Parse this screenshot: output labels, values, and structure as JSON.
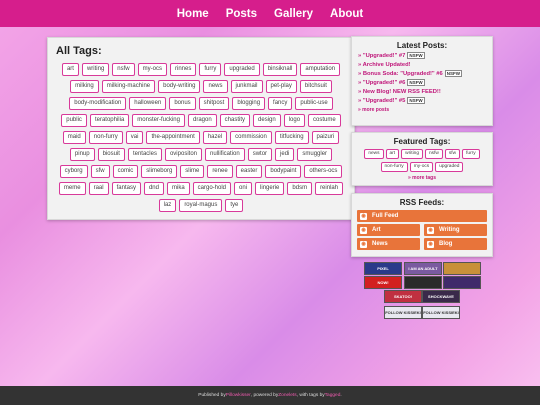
{
  "nav": [
    "Home",
    "Posts",
    "Gallery",
    "About"
  ],
  "all_tags": {
    "title": "All Tags:",
    "tags": [
      "art",
      "writing",
      "nsfw",
      "my-ocs",
      "rinnes",
      "furry",
      "upgraded",
      "binsiknall",
      "amputation",
      "milking",
      "milking-machine",
      "body-writing",
      "news",
      "junkmail",
      "pet-play",
      "bitchsuit",
      "body-modification",
      "halloween",
      "bonus",
      "shitpost",
      "blogging",
      "fancy",
      "public-use",
      "public",
      "teratophilia",
      "monster-fucking",
      "dragon",
      "chastity",
      "design",
      "logo",
      "costume",
      "maid",
      "non-furry",
      "vai",
      "the-appointment",
      "hazel",
      "commission",
      "titfucking",
      "paizuri",
      "pinup",
      "biosuit",
      "tentacles",
      "ovipositon",
      "nullification",
      "swtor",
      "jedi",
      "smuggler",
      "cyborg",
      "sfw",
      "comic",
      "slimeborg",
      "slime",
      "renee",
      "easter",
      "bodypaint",
      "others-ocs",
      "meme",
      "raal",
      "fantasy",
      "dnd",
      "mika",
      "cargo-hold",
      "oni",
      "lingerie",
      "bdsm",
      "reinlah",
      "laz",
      "royal-magus",
      "tye"
    ]
  },
  "latest": {
    "title": "Latest Posts:",
    "posts": [
      {
        "text": "» \"Upgraded!\" #7",
        "nsfw": "NSFW"
      },
      {
        "text": "» Archive Updated!",
        "nsfw": ""
      },
      {
        "text": "» Bonus Soda: \"Upgraded!\" #6",
        "nsfw": "NSFW"
      },
      {
        "text": "» \"Upgraded!\" #6",
        "nsfw": "NSFW"
      },
      {
        "text": "» New Blog! NEW RSS FEED!!",
        "nsfw": ""
      },
      {
        "text": "» \"Upgraded!\" #5",
        "nsfw": "NSFW"
      }
    ],
    "more": "» more posts"
  },
  "featured": {
    "title": "Featured Tags:",
    "tags": [
      "news",
      "art",
      "writing",
      "nsfw",
      "sfw",
      "furry",
      "non-furry",
      "my-ocs",
      "upgraded"
    ],
    "more": "» more tags"
  },
  "rss": {
    "title": "RSS Feeds:",
    "full": "Full Feed",
    "art": "Art",
    "writing": "Writing",
    "news": "News",
    "blog": "Blog"
  },
  "badges": [
    {
      "name": "badge-1",
      "color": "#2a3a8a",
      "text": "PIXEL"
    },
    {
      "name": "badge-2",
      "color": "#7a5aa0",
      "text": "I AM AN ADULT"
    },
    {
      "name": "badge-3",
      "color": "#c8903a",
      "text": ""
    },
    {
      "name": "badge-4",
      "color": "#d22020",
      "text": "NOW!"
    },
    {
      "name": "badge-5",
      "color": "#2a2a2a",
      "text": ""
    },
    {
      "name": "badge-6",
      "color": "#402a6a",
      "text": ""
    },
    {
      "name": "badge-7",
      "color": "#c03040",
      "text": "SKATOO!"
    },
    {
      "name": "badge-8",
      "color": "#3a2a4a",
      "text": "SHOCKWAVE"
    },
    {
      "name": "badge-9",
      "color": "#e8e8f0",
      "text": "FOLLOW KISSIEKI"
    },
    {
      "name": "badge-10",
      "color": "#e8e8f0",
      "text": "FOLLOW KISSIEKI"
    }
  ],
  "footer": {
    "pre": "Published by ",
    "author": "Pillowkisser",
    "mid": ", powered by ",
    "engine": "Zonelets",
    "mid2": ", with tags by ",
    "tagger": "Tagged",
    "end": "."
  }
}
